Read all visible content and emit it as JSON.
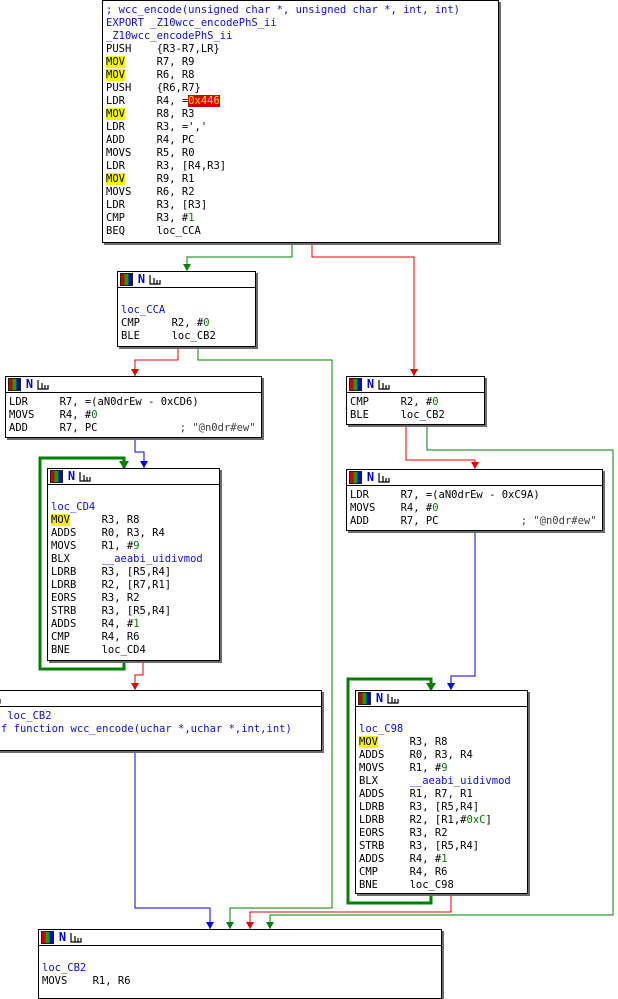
{
  "colors": {
    "true_edge": "#008000",
    "false_edge": "#e00000",
    "uncond_edge": "#0000e0",
    "highlight": "#f4f400"
  },
  "top_block": {
    "lines": [
      {
        "c": "; wcc_encode(unsigned char *, unsigned char *, int, int)"
      },
      {
        "c": "EXPORT _Z10wcc_encodePhS_ii"
      },
      {
        "c": "_Z10wcc_encodePhS_ii"
      },
      {
        "m": "PUSH",
        "o": "{R3-R7,LR}"
      },
      {
        "m": "MOV",
        "o": "R7, R9",
        "hl": true
      },
      {
        "m": "MOV",
        "o": "R6, R8",
        "hl": true
      },
      {
        "m": "PUSH",
        "o": "{R6,R7}"
      },
      {
        "m": "LDR",
        "o": "R4, =",
        "red": "0x446"
      },
      {
        "m": "MOV",
        "o": "R8, R3",
        "hl": true
      },
      {
        "m": "LDR",
        "o": "R3, =','"
      },
      {
        "m": "ADD",
        "o": "R4, PC"
      },
      {
        "m": "MOVS",
        "o": "R5, R0"
      },
      {
        "m": "LDR",
        "o": "R3, [R4,R3]"
      },
      {
        "m": "MOV",
        "o": "R9, R1",
        "hl": true
      },
      {
        "m": "MOVS",
        "o": "R6, R2"
      },
      {
        "m": "LDR",
        "o": "R3, [R3]"
      },
      {
        "m": "CMP",
        "o": "R3, #",
        "n": "1"
      },
      {
        "m": "BEQ",
        "o": "loc_CCA"
      }
    ]
  },
  "loc_cca": {
    "lines": [
      {
        "c": ""
      },
      {
        "c": "loc_CCA"
      },
      {
        "m": "CMP",
        "o": "R2, #",
        "n": "0"
      },
      {
        "m": "BLE",
        "o": "loc_CB2"
      }
    ]
  },
  "ldr_cd6": {
    "lines": [
      {
        "m": "LDR",
        "o": "R7, =(aN0drEw - 0xCD6)"
      },
      {
        "m": "MOVS",
        "o": "R4, #",
        "n": "0"
      },
      {
        "m": "ADD",
        "o": "R7, PC",
        "cmt": "             ; \"@n0dr#ew\""
      }
    ]
  },
  "cmp_r2": {
    "lines": [
      {
        "m": "CMP",
        "o": "R2, #",
        "n": "0"
      },
      {
        "m": "BLE",
        "o": "loc_CB2"
      }
    ]
  },
  "loop_cd4": {
    "lines": [
      {
        "c": ""
      },
      {
        "c": "loc_CD4"
      },
      {
        "m": "MOV",
        "o": "R3, R8",
        "hl": true
      },
      {
        "m": "ADDS",
        "o": "R0, R3, R4"
      },
      {
        "m": "MOVS",
        "o": "R1, #",
        "n": "9"
      },
      {
        "m": "BLX",
        "o": "__aeabi_uidivmod",
        "ob": true
      },
      {
        "m": "LDRB",
        "o": "R3, [R5,R4]"
      },
      {
        "m": "LDRB",
        "o": "R2, [R7,R1]"
      },
      {
        "m": "EORS",
        "o": "R3, R2"
      },
      {
        "m": "STRB",
        "o": "R3, [R5,R4]"
      },
      {
        "m": "ADDS",
        "o": "R4, #",
        "n": "1"
      },
      {
        "m": "CMP",
        "o": "R4, R6"
      },
      {
        "m": "BNE",
        "o": "loc_CD4"
      }
    ]
  },
  "ldr_c9a": {
    "lines": [
      {
        "m": "LDR",
        "o": "R7, =(aN0drEw - 0xC9A)"
      },
      {
        "m": "MOVS",
        "o": "R4, #",
        "n": "0"
      },
      {
        "m": "ADD",
        "o": "R7, PC",
        "cmt": "             ; \"@n0dr#ew\""
      }
    ]
  },
  "end_block": {
    "lines": [
      {
        "c": " loc_CB2"
      },
      {
        "c": "f function wcc_encode(uchar *,uchar *,int,int)"
      }
    ]
  },
  "loop_c98": {
    "lines": [
      {
        "c": ""
      },
      {
        "c": "loc_C98"
      },
      {
        "m": "MOV",
        "o": "R3, R8",
        "hl": true
      },
      {
        "m": "ADDS",
        "o": "R0, R3, R4"
      },
      {
        "m": "MOVS",
        "o": "R1, #",
        "n": "9"
      },
      {
        "m": "BLX",
        "o": "__aeabi_uidivmod",
        "ob": true
      },
      {
        "m": "ADDS",
        "o": "R1, R7, R1"
      },
      {
        "m": "LDRB",
        "o": "R3, [R5,R4]"
      },
      {
        "m": "LDRB",
        "o": "R2, [R1,#",
        "n": "0xC",
        "tail": "]"
      },
      {
        "m": "EORS",
        "o": "R3, R2"
      },
      {
        "m": "STRB",
        "o": "R3, [R5,R4]"
      },
      {
        "m": "ADDS",
        "o": "R4, #",
        "n": "1"
      },
      {
        "m": "CMP",
        "o": "R4, R6"
      },
      {
        "m": "BNE",
        "o": "loc_C98"
      }
    ]
  },
  "loc_cb2_bottom": {
    "lines": [
      {
        "c": ""
      },
      {
        "c": "loc_CB2"
      },
      {
        "m": "MOVS",
        "o": "R1, R6"
      }
    ]
  }
}
